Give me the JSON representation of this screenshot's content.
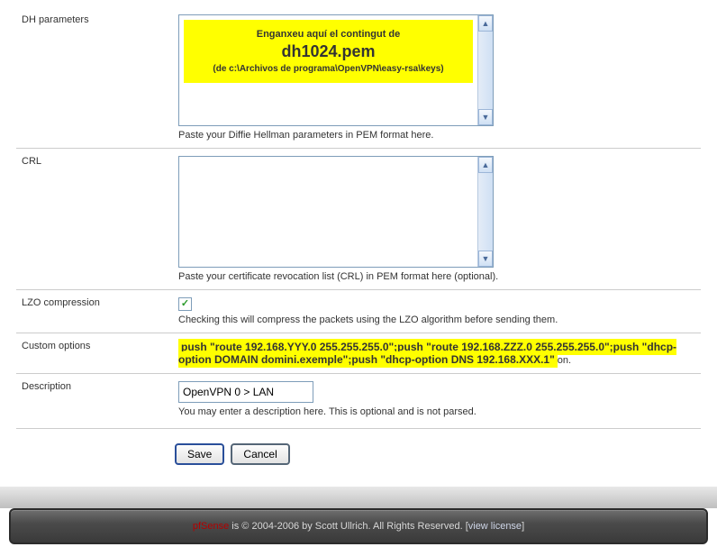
{
  "rows": {
    "dh": {
      "label": "DH parameters",
      "box": {
        "line1": "Enganxeu aquí el contingut de",
        "big": "dh1024.pem",
        "line3": "(de c:\\Archivos de programa\\OpenVPN\\easy-rsa\\keys)"
      },
      "help": "Paste your Diffie Hellman parameters in PEM format here."
    },
    "crl": {
      "label": "CRL",
      "help": "Paste your certificate revocation list (CRL) in PEM format here (optional)."
    },
    "lzo": {
      "label": "LZO compression",
      "checked": true,
      "help": "Checking this will compress the packets using the LZO algorithm before sending them."
    },
    "custom": {
      "label": "Custom options",
      "highlight": "push \"route 192.168.YYY.0 255.255.255.0\";push \"route 192.168.ZZZ.0 255.255.255.0\";push \"dhcp-option DOMAIN domini.exemple\";push \"dhcp-option DNS 192.168.XXX.1\"",
      "trail": "on."
    },
    "desc": {
      "label": "Description",
      "value": "OpenVPN 0 > LAN",
      "help": "You may enter a description here. This is optional and is not parsed."
    }
  },
  "buttons": {
    "save": "Save",
    "cancel": "Cancel"
  },
  "footer": {
    "brand": "pfSense",
    "text1": " is © 2004-2006 by Scott Ullrich. All Rights Reserved. [",
    "link": "view license",
    "text2": "]"
  }
}
